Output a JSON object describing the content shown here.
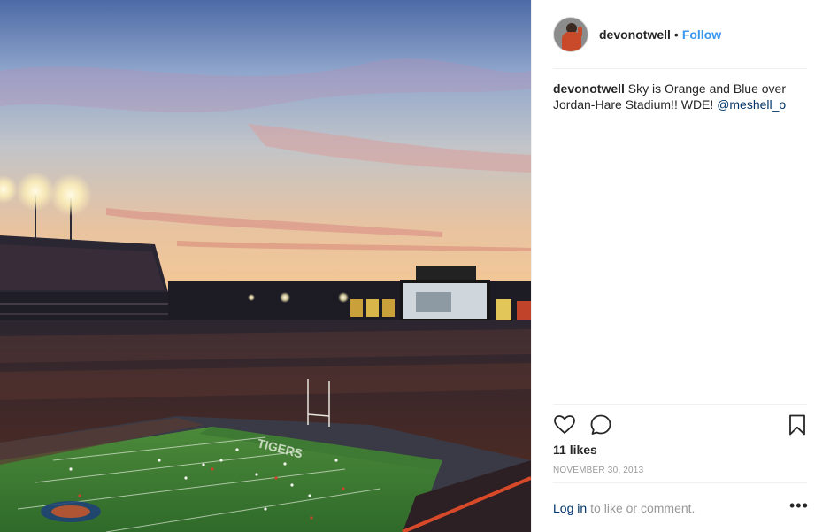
{
  "header": {
    "username": "devonotwell",
    "separator": "•",
    "follow_label": "Follow"
  },
  "caption": {
    "username": "devonotwell",
    "text": "Sky is Orange and Blue over Jordan-Hare Stadium!! WDE!",
    "mention": "@meshell_o"
  },
  "photo": {
    "field_text": "TIGERS",
    "alt": "Jordan-Hare Stadium at sunset"
  },
  "stats": {
    "likes": "11 likes",
    "date": "November 30, 2013"
  },
  "footer": {
    "login_label": "Log in",
    "rest_text": "to like or comment.",
    "more_label": "•••"
  },
  "icons": {
    "like": "heart-icon",
    "comment": "comment-icon",
    "save": "bookmark-icon",
    "more": "more-options-icon"
  },
  "colors": {
    "link": "#3897f0",
    "mention": "#003569",
    "text": "#262626",
    "muted": "#999999",
    "border": "#efefef"
  }
}
